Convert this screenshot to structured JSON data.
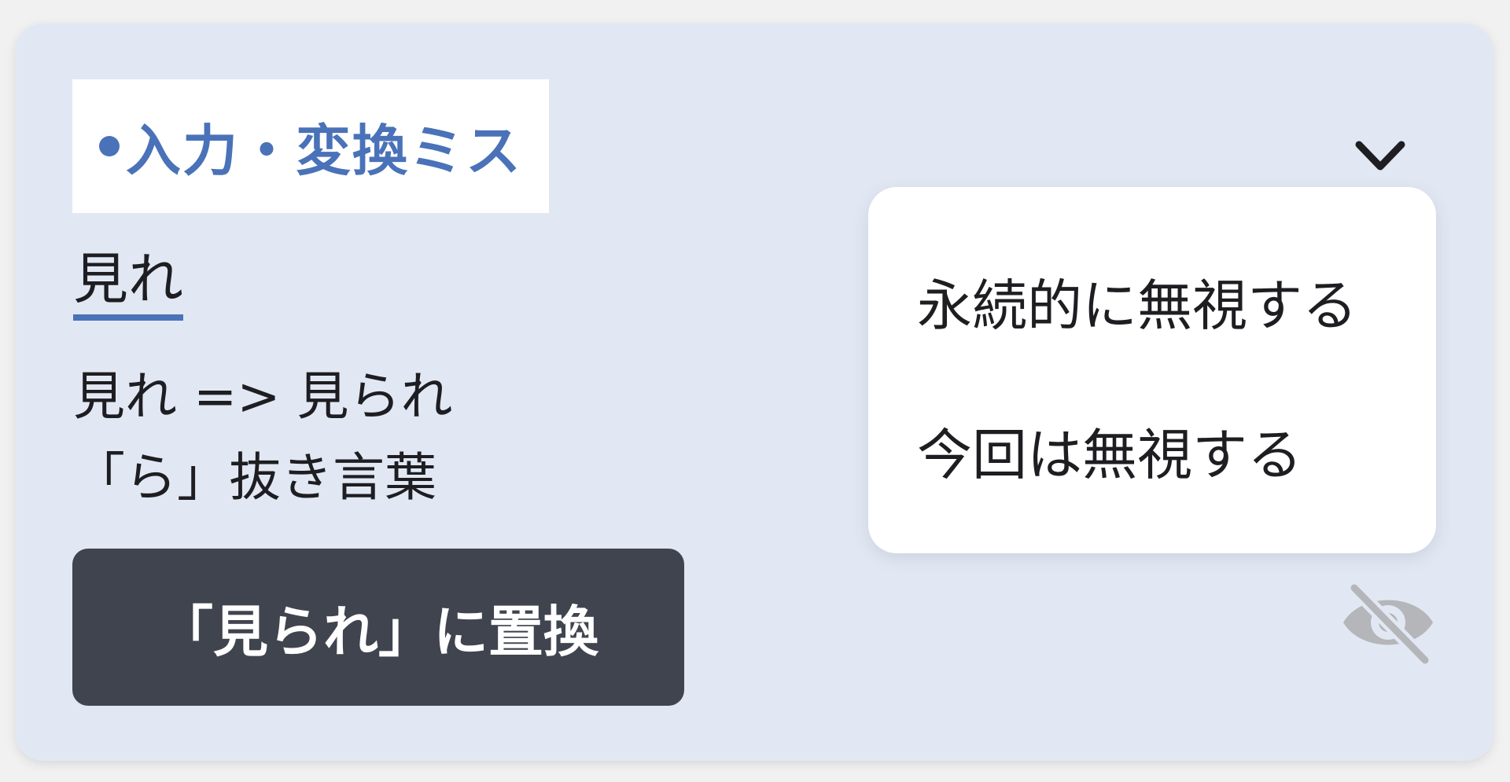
{
  "category": {
    "label": "入力・変換ミス",
    "color": "#4a72b8"
  },
  "error": {
    "word": "見れ",
    "suggestion": "見れ => 見られ",
    "reason": "「ら」抜き言葉"
  },
  "actions": {
    "replace_label": "「見られ」に置換"
  },
  "ignore_menu": {
    "items": [
      "永続的に無視する",
      "今回は無視する"
    ]
  },
  "icons": {
    "collapse": "chevron-down-icon",
    "ignore": "eye-off-icon"
  }
}
